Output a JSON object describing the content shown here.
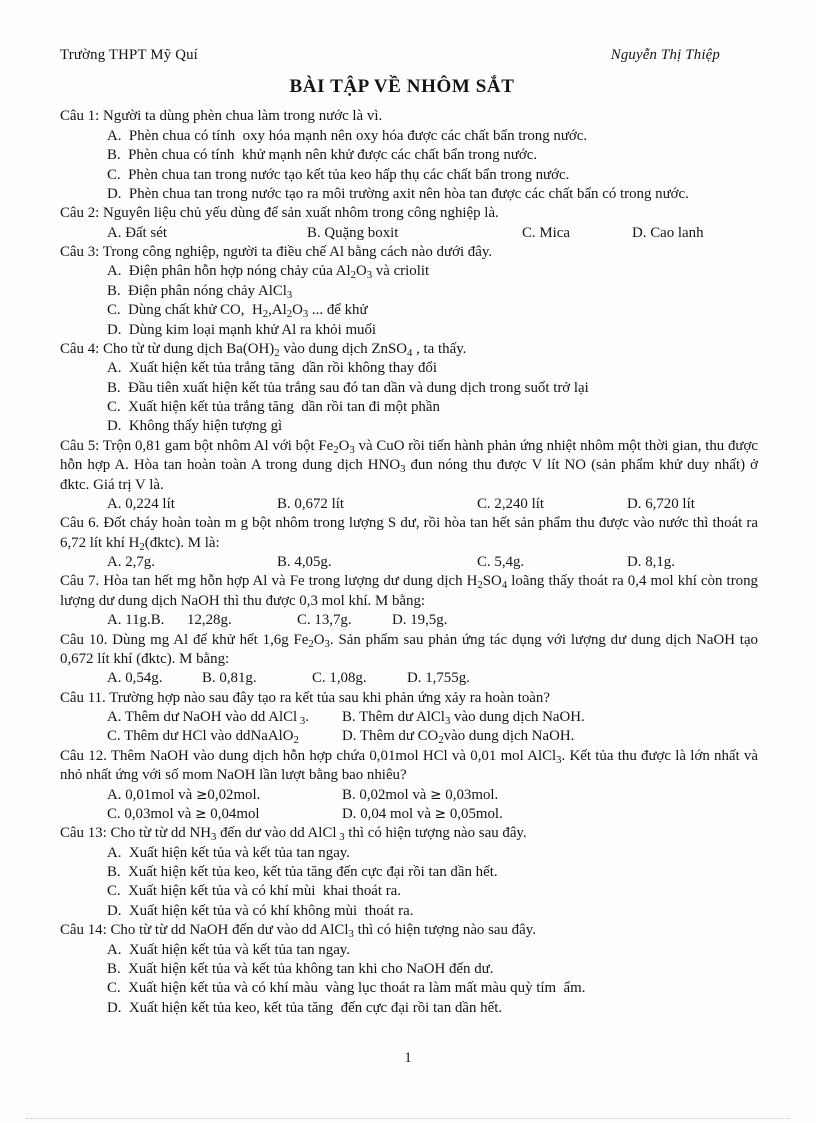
{
  "header": {
    "school": "Trường THPT Mỹ Quí",
    "author": "Nguyễn Thị Thiệp",
    "title": "BÀI TẬP VỀ NHÔM SẮT"
  },
  "page_number": "1",
  "questions": [
    {
      "stem": "Câu 1: Người ta dùng phèn chua làm trong nước là vì.",
      "layout": "stacked",
      "options": [
        "A.  Phèn chua có tính  oxy hóa mạnh nên oxy hóa được các chất bẩn trong nước.",
        "B.  Phèn chua có tính  khử mạnh nên khử được các chất bẩn trong nước.",
        "C.  Phèn chua tan trong nước tạo kết tủa keo hấp thụ các chất bẩn trong nước.",
        "D.  Phèn chua tan trong nước tạo ra môi trường axit nên hòa tan được các chất bẩn có trong nước."
      ]
    },
    {
      "stem": "Câu 2: Nguyên liệu chủ yếu dùng để sản xuất nhôm trong công nghiệp  là.",
      "layout": "row",
      "row_widths": [
        "w-200",
        "w-215",
        "w-110",
        "w-120"
      ],
      "options": [
        "A.  Đất sét",
        "B.  Quặng boxit",
        "C.  Mica",
        "D.  Cao lanh"
      ]
    },
    {
      "stem": "Câu 3: Trong công nghiệp,  người ta điều chế Al bằng cách nào dưới đây.",
      "layout": "stacked",
      "options_html": [
        "A.  Điện phân hỗn hợp nóng chảy của Al<sub>2</sub>O<sub>3</sub> và criolit",
        "B.  Điện phân nóng chảy AlCl<sub>3</sub>",
        "C.  Dùng chất khử CO,  H<sub>2</sub>,Al<sub>2</sub>O<sub>3</sub> ... để khử",
        "D.  Dùng kim loại mạnh khử Al ra khỏi muối"
      ]
    },
    {
      "stem_html": "Câu 4: Cho từ từ dung dịch Ba(OH)<sub>2</sub> vào dung dịch ZnSO<sub>4</sub> , ta thấy.",
      "layout": "stacked",
      "options": [
        "A.  Xuất hiện kết tủa trắng tăng  dần rồi không thay đổi",
        "B.  Đầu tiên xuất hiện kết tủa trắng sau đó tan dần và dung dịch trong suốt trở lại",
        "C.  Xuất hiện kết tủa trắng tăng  dần rồi tan đi một phần",
        "D.  Không thấy hiện tượng gì"
      ]
    },
    {
      "stem_html": "Câu 5: Trộn 0,81 gam bột nhôm  Al với bột Fe<sub>2</sub>O<sub>3</sub> và CuO rồi tiến hành phản ứng nhiệt nhôm một thời gian, thu được hỗn hợp A. Hòa tan hoàn toàn A trong dung dịch  HNO<sub>3</sub> đun nóng thu được V lít NO (sản phẩm khử duy nhất) ở đktc. Giá trị V là.",
      "layout": "row",
      "row_widths": [
        "w-170",
        "w-200",
        "w-150",
        "w-120"
      ],
      "options": [
        "A.  0,224 lít",
        "B.  0,672 lít",
        "C.  2,240 lít",
        "D.  6,720 lít"
      ]
    },
    {
      "stem_html": "Câu 6. Đốt cháy hoàn toàn m g bột nhôm  trong lượng S dư, rồi hòa tan hết sản phẩm thu được vào nước thì thoát ra 6,72 lít khí H<sub>2</sub>(đktc). M là:",
      "layout": "row",
      "row_widths": [
        "w-170",
        "w-200",
        "w-150",
        "w-120"
      ],
      "options": [
        "A. 2,7g.",
        "B. 4,05g.",
        "C. 5,4g.",
        "D. 8,1g."
      ]
    },
    {
      "stem_html": "Câu 7. Hòa tan hết mg hỗn hợp Al và Fe trong lượng dư dung dịch H<sub>2</sub>SO<sub>4</sub> loãng thấy thoát ra 0,4 mol khí còn trong lượng dư dung dịch NaOH thì thu được 0,3 mol khí. M bằng:",
      "layout": "row",
      "row_widths": [
        "w-80",
        "w-110",
        "w-95",
        "w-110"
      ],
      "options": [
        "A. 11g.B.",
        "12,28g.",
        "C. 13,7g.",
        "D. 19,5g."
      ]
    },
    {
      "stem_html": "Câu 10. Dùng  mg  Al để khử hết 1,6g Fe<sub>2</sub>O<sub>3</sub>. Sản phẩm sau phản ứng tác dụng với lượng  dư dung dịch NaOH tạo 0,672 lít khí (đktc). M bằng:",
      "layout": "row",
      "row_widths": [
        "w-95",
        "w-110",
        "w-95",
        "w-110"
      ],
      "options": [
        "A. 0,54g.",
        "B. 0,81g.",
        "C. 1,08g.",
        "D. 1,755g."
      ]
    },
    {
      "stem": "Câu 11. Trường hợp nào sau đây tạo ra kết tủa sau khi phản ứng xảy ra hoàn toàn?",
      "layout": "pairs",
      "pair_width": "w-235",
      "options_html": [
        "A. Thêm  dư NaOH vào dd AlCl<sub> 3</sub>.",
        "B. Thêm  dư AlCl<sub>3</sub> vào dung dịch NaOH.",
        "C. Thêm  dư HCl vào ddNaAlO<sub>2</sub>",
        "D. Thêm  dư CO<sub>2</sub>vào dung dịch NaOH."
      ]
    },
    {
      "stem_html": "Câu 12. Thêm  NaOH vào dung dịch hỗn hợp chứa 0,01mol  HCl và 0,01 mol  AlCl<sub>3</sub>. Kết tủa thu được là lớn nhất và nhỏ nhất ứng với số mom  NaOH lần lượt bằng bao nhiêu?",
      "layout": "pairs",
      "pair_width": "w-235",
      "options_html": [
        "A. 0,01mol và <span class=\"ge\">≥</span>0,02mol.",
        "B. 0,02mol và <span class=\"ge\">≥</span> 0,03mol.",
        "C. 0,03mol và <span class=\"ge\">≥</span> 0,04mol",
        "D. 0,04 mol và <span class=\"ge\">≥</span> 0,05mol."
      ]
    },
    {
      "stem_html": "Câu 13: Cho từ từ dd NH<sub>3</sub> đến dư vào dd AlCl<sub> 3</sub>  thì có hiện tượng nào sau đây.",
      "layout": "stacked",
      "options": [
        "A.  Xuất hiện kết tủa và kết tủa tan ngay.",
        "B.  Xuất hiện kết tủa keo, kết tủa tăng đến cực đại rồi tan dần hết.",
        "C.  Xuất hiện kết tủa và có khí mùi  khai thoát ra.",
        "D.  Xuất hiện kết tủa và có khí không mùi  thoát ra."
      ]
    },
    {
      "stem_html": "Câu 14: Cho từ từ dd NaOH đến dư vào dd AlCl<sub>3</sub> thì có hiện tượng nào sau đây.",
      "layout": "stacked",
      "options": [
        "A.  Xuất hiện kết tủa và kết tủa tan ngay.",
        "B.  Xuất hiện kết tủa và kết tủa không tan khi cho NaOH đến dư.",
        "C.  Xuất hiện kết tủa và có khí màu  vàng lục thoát ra làm mất màu quỳ tím  ẩm.",
        "D.  Xuất hiện kết tủa keo, kết tủa tăng  đến cực đại rồi tan dần hết."
      ]
    }
  ]
}
